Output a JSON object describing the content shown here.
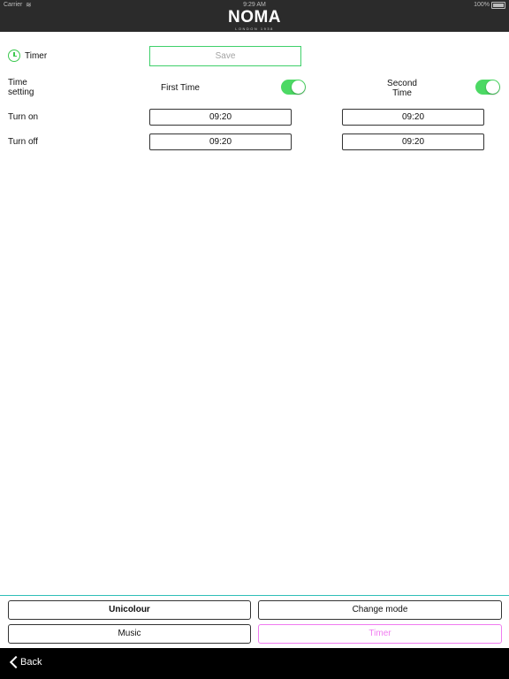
{
  "status_bar": {
    "carrier": "Carrier",
    "time": "9:29 AM",
    "battery": "100%"
  },
  "header": {
    "brand": "NOMA",
    "tagline": "LONDON 1938"
  },
  "timer": {
    "label": "Timer",
    "save_label": "Save"
  },
  "time_setting": {
    "label_line1": "Time",
    "label_line2": "setting",
    "first_time_label": "First Time",
    "second_time_line1": "Second",
    "second_time_line2": "Time",
    "first_enabled": true,
    "second_enabled": true
  },
  "turn_on": {
    "label": "Turn on",
    "first": "09:20",
    "second": "09:20"
  },
  "turn_off": {
    "label": "Turn off",
    "first": "09:20",
    "second": "09:20"
  },
  "nav": {
    "unicolour": "Unicolour",
    "change_mode": "Change mode",
    "music": "Music",
    "timer": "Timer"
  },
  "footer": {
    "back_label": "Back"
  },
  "colors": {
    "accent_green": "#4cd964",
    "active_pink": "#f07cf0",
    "divider_teal": "#2fbfb8"
  }
}
